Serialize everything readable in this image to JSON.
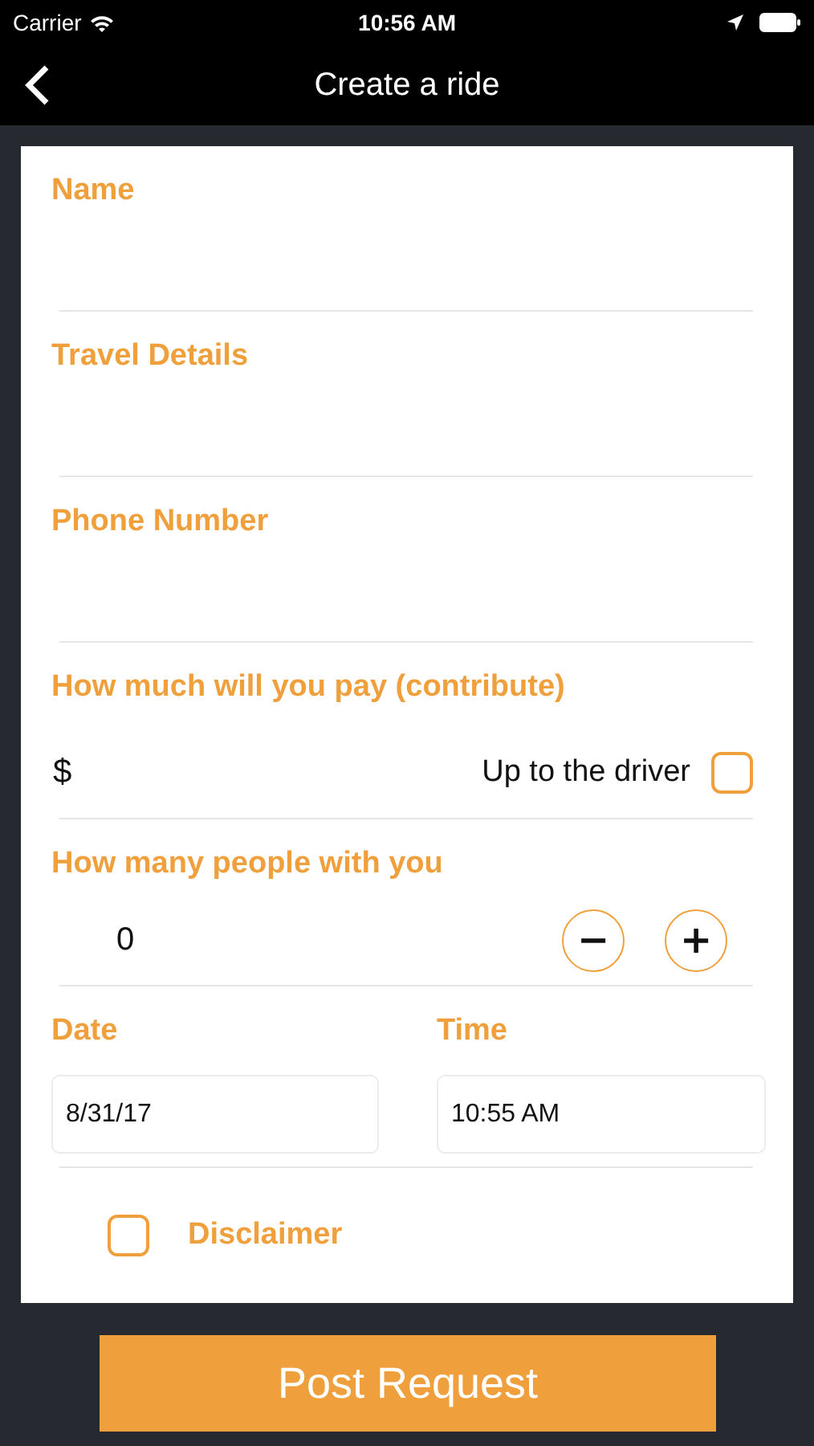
{
  "status_bar": {
    "carrier": "Carrier",
    "time": "10:56 AM"
  },
  "nav": {
    "title": "Create a ride"
  },
  "form": {
    "text_fields": [
      {
        "label": "Name"
      },
      {
        "label": "Travel Details"
      },
      {
        "label": "Phone Number"
      }
    ],
    "payment": {
      "label": "How much will you pay (contribute)",
      "currency": "$",
      "driver_option": {
        "label": "Up to the driver",
        "checked": false
      }
    },
    "people": {
      "label": "How many people with you",
      "count": "0",
      "decrement": "−",
      "increment": "+"
    },
    "date": {
      "label": "Date",
      "value": "8/31/17"
    },
    "time": {
      "label": "Time",
      "value": "10:55 AM"
    },
    "disclaimer": {
      "label": "Disclaimer",
      "checked": false
    }
  },
  "submit": {
    "label": "Post Request"
  }
}
